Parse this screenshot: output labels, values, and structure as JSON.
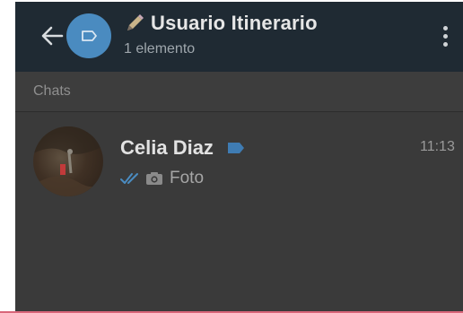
{
  "header": {
    "back_icon": "arrow-left-icon",
    "avatar_icon": "tag-icon",
    "title_icon": "pencil-icon",
    "title": "Usuario Itinerario",
    "subtitle": "1 elemento",
    "menu_icon": "more-vertical-icon"
  },
  "section": {
    "label": "Chats"
  },
  "chats": [
    {
      "name": "Celia Diaz",
      "label_icon": "label-tag-icon",
      "time": "11:13",
      "status_icon": "double-check-icon",
      "media_icon": "camera-icon",
      "preview": "Foto"
    }
  ],
  "colors": {
    "header_bg": "#1f2a33",
    "body_bg": "#3a3a3a",
    "accent_blue": "#4a8bc0",
    "read_check": "#4a8bc0",
    "bottom_accent": "#d9667a"
  }
}
